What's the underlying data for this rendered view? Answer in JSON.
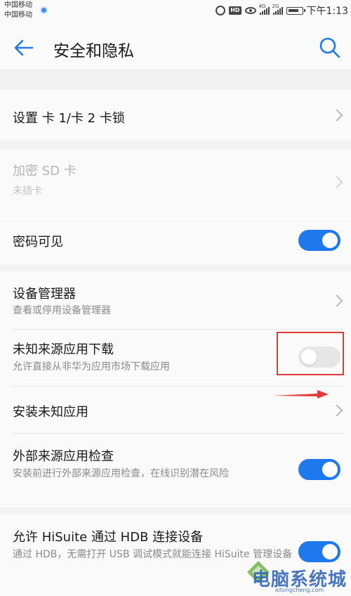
{
  "status_bar": {
    "carrier1": "中国移动",
    "carrier2": "中国移动",
    "hd": "HD",
    "net1": "4G",
    "net2": "2G",
    "time": "下午1:13"
  },
  "app_bar": {
    "title": "安全和隐私",
    "back_icon": "back-arrow-icon",
    "search_icon": "search-icon",
    "accent_color": "#1e78ee"
  },
  "items": {
    "sim_lock": {
      "label": "设置 卡 1/卡 2 卡锁"
    },
    "encrypt_sd": {
      "label": "加密 SD 卡",
      "sub": "未插卡",
      "disabled": true
    },
    "password_visible": {
      "label": "密码可见",
      "toggle": true
    },
    "device_admin": {
      "label": "设备管理器",
      "sub": "查看或停用设备管理器"
    },
    "unknown_sources": {
      "label": "未知来源应用下载",
      "sub": "允许直接从非华为应用市场下载应用",
      "toggle": false
    },
    "install_unknown": {
      "label": "安装未知应用"
    },
    "external_check": {
      "label": "外部来源应用检查",
      "sub": "安装前进行外部来源应用检查，在线识别潜在风险",
      "toggle": true
    },
    "hisuite": {
      "label": "允许 HiSuite 通过 HDB 连接设备",
      "sub": "通过 HDB，无需打开 USB 调试模式就能连接 HiSuite 管理设备",
      "toggle": true
    }
  },
  "annotation": {
    "highlight_color": "#e23a3a"
  },
  "watermark": {
    "text": "电脑系统城",
    "url": "xitongcheng.com"
  }
}
